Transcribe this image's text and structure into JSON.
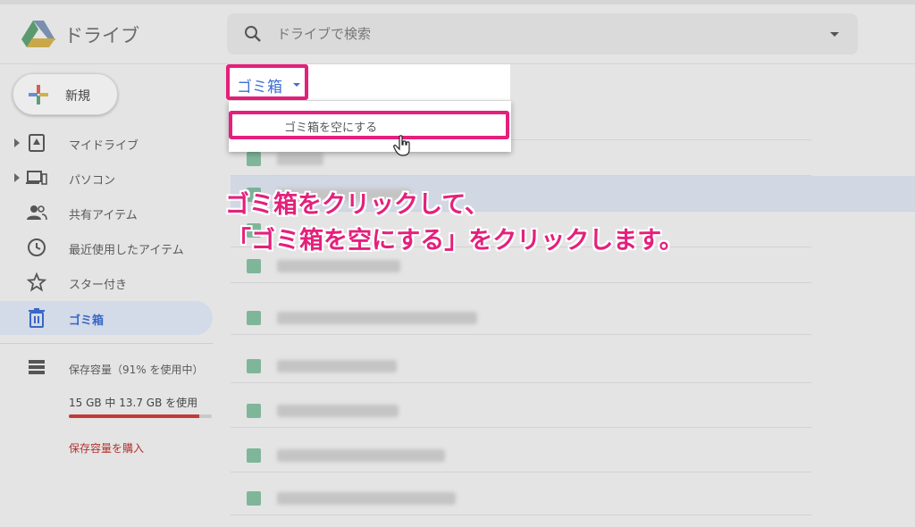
{
  "app": {
    "title": "ドライブ"
  },
  "search": {
    "placeholder": "ドライブで検索"
  },
  "sidebar": {
    "new_button": "新規",
    "items": [
      {
        "label": "マイドライブ",
        "icon": "drive-folder-icon",
        "expandable": true
      },
      {
        "label": "パソコン",
        "icon": "computer-icon",
        "expandable": true
      },
      {
        "label": "共有アイテム",
        "icon": "people-icon",
        "expandable": false
      },
      {
        "label": "最近使用したアイテム",
        "icon": "clock-icon",
        "expandable": false
      },
      {
        "label": "スター付き",
        "icon": "star-icon",
        "expandable": false
      },
      {
        "label": "ゴミ箱",
        "icon": "trash-icon",
        "expandable": false,
        "active": true
      }
    ],
    "storage": {
      "label": "保存容量（91% を使用中）",
      "used_text": "15 GB 中 13.7 GB を使用",
      "used_fraction": 0.91,
      "buy_link": "保存容量を購入"
    }
  },
  "breadcrumb": {
    "label": "ゴミ箱"
  },
  "dropdown_menu": {
    "items": [
      "ゴミ箱を空にする"
    ]
  },
  "annotation": {
    "line1": "ゴミ箱をクリックして、",
    "line2": "「ゴミ箱を空にする」をクリックします。",
    "highlight_color": "#e4207c"
  },
  "colors": {
    "accent_blue": "#3f6fd0",
    "danger_red": "#c23a3a"
  }
}
